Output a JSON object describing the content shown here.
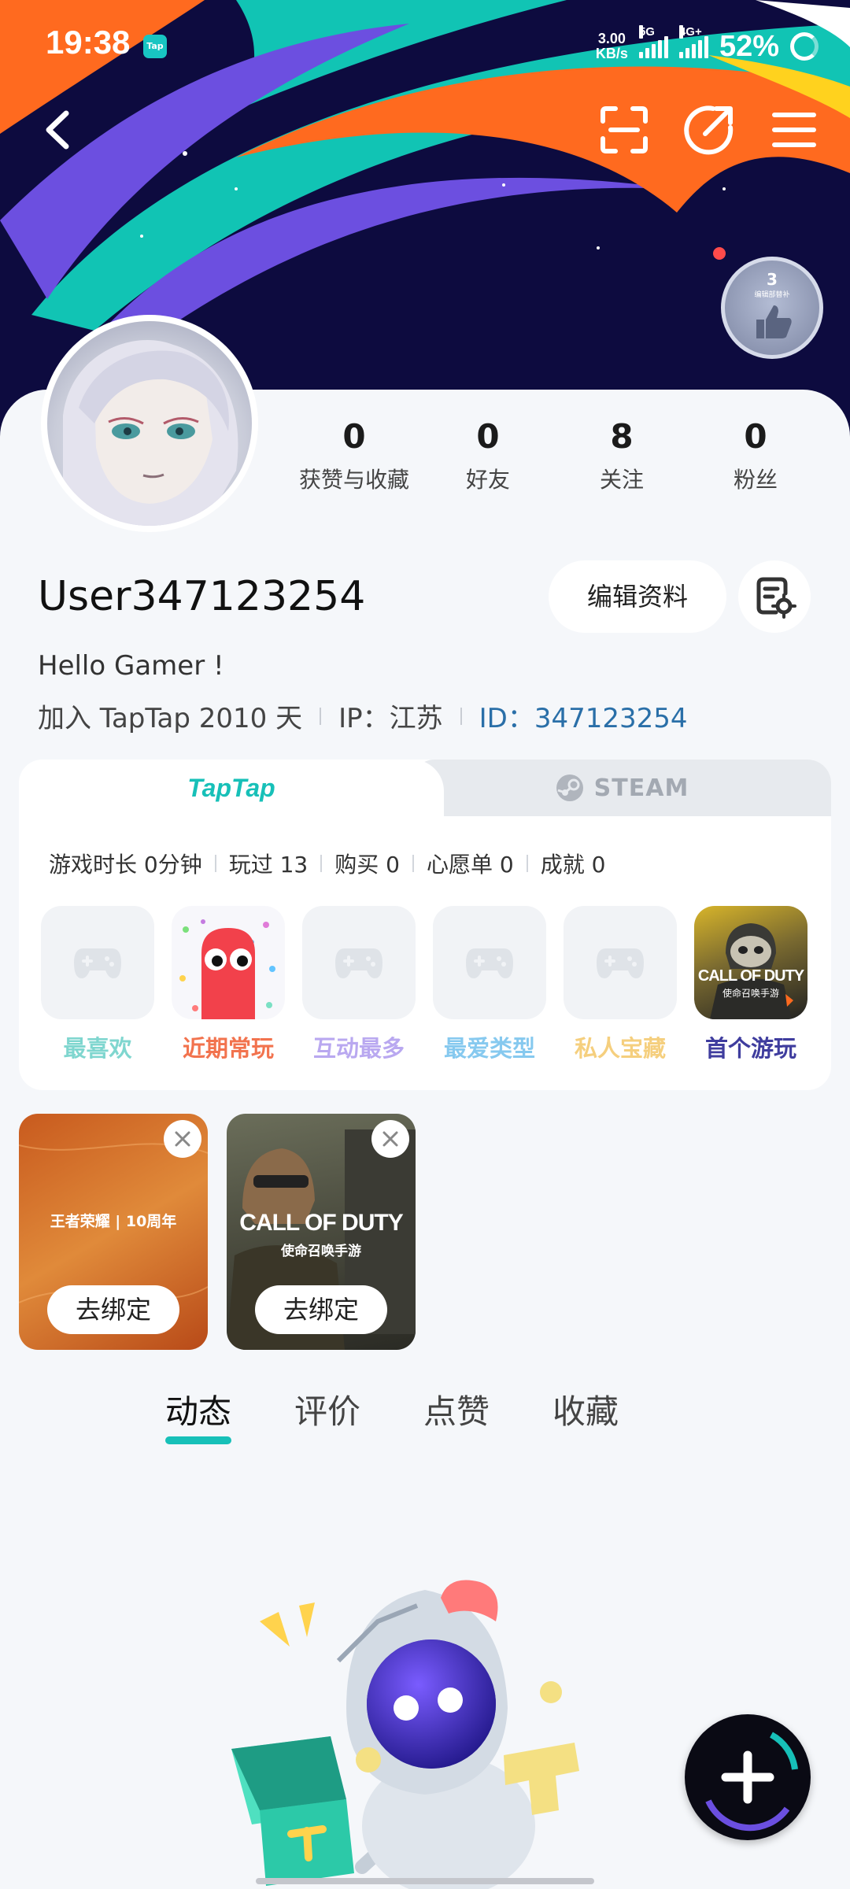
{
  "status_bar": {
    "time": "19:38",
    "app_badge": "Tap",
    "net_speed_value": "3.00",
    "net_speed_unit": "KB/s",
    "signal1_label": "5G",
    "signal2_label": "4G+",
    "battery": "52%"
  },
  "header": {
    "back_icon": "back-arrow-icon",
    "scan_icon": "scan-icon",
    "share_icon": "share-icon",
    "menu_icon": "menu-icon",
    "medal_count": "3",
    "medal_caption": "编辑部替补"
  },
  "profile": {
    "stats": [
      {
        "value": "0",
        "label": "获赞与收藏"
      },
      {
        "value": "0",
        "label": "好友"
      },
      {
        "value": "8",
        "label": "关注"
      },
      {
        "value": "0",
        "label": "粉丝"
      }
    ],
    "username": "User347123254",
    "edit_button": "编辑资料",
    "bio": "Hello Gamer !",
    "joined": "加入 TapTap 2010 天",
    "ip": "IP：江苏",
    "id": "ID：347123254"
  },
  "game_card": {
    "tab_taptap": "TapTap",
    "tab_steam": "STEAM",
    "stats": [
      "游戏时长 0分钟",
      "玩过 13",
      "购买 0",
      "心愿单 0",
      "成就 0"
    ],
    "tiles": [
      {
        "label": "最喜欢",
        "color": "#7fd6cf"
      },
      {
        "label": "近期常玩",
        "color": "#f2734e"
      },
      {
        "label": "互动最多",
        "color": "#b9a8f0"
      },
      {
        "label": "最爱类型",
        "color": "#86c9ef"
      },
      {
        "label": "私人宝藏",
        "color": "#f5cf7e"
      },
      {
        "label": "首个游玩",
        "color": "#3f3d9e"
      }
    ],
    "codm_logo_text": "CALL OF DUTY",
    "codm_logo_sub": "使命召唤手游"
  },
  "bind_cards": [
    {
      "logo": "王者荣耀 | 10周年",
      "button": "去绑定"
    },
    {
      "logo": "CALL OF DUTY",
      "logo_sub": "使命召唤手游",
      "button": "去绑定"
    }
  ],
  "feed_tabs": [
    "动态",
    "评价",
    "点赞",
    "收藏"
  ],
  "colors": {
    "accent": "#17c0b8",
    "id_link": "#2a6fa8",
    "banner_bg": "#0d0b3f"
  }
}
